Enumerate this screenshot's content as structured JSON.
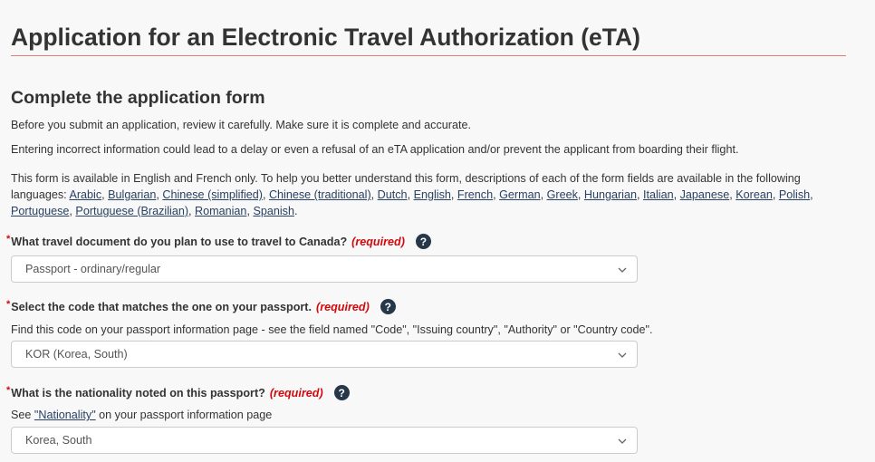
{
  "page": {
    "title": "Application for an Electronic Travel Authorization (eTA)",
    "subtitle": "Complete the application form",
    "intro1": "Before you submit an application, review it carefully. Make sure it is complete and accurate.",
    "intro2": "Entering incorrect information could lead to a delay or even a refusal of an eTA application and/or prevent the applicant from boarding their flight.",
    "intro3": "This form is available in English and French only. To help you better understand this form, descriptions of each of the form fields are available in the following languages:"
  },
  "languages": [
    "Arabic",
    "Bulgarian",
    "Chinese (simplified)",
    "Chinese (traditional)",
    "Dutch",
    "English",
    "French",
    "German",
    "Greek",
    "Hungarian",
    "Italian",
    "Japanese",
    "Korean",
    "Polish",
    "Portuguese",
    "Portuguese (Brazilian)",
    "Romanian",
    "Spanish"
  ],
  "required_marker": "*",
  "required_label": "(required)",
  "questions": [
    {
      "label": "What travel document do you plan to use to travel to Canada?",
      "hint": "",
      "value": "Passport - ordinary/regular"
    },
    {
      "label": "Select the code that matches the one on your passport.",
      "hint": "Find this code on your passport information page - see the field named \"Code\", \"Issuing country\", \"Authority\" or \"Country code\".",
      "value": "KOR (Korea, South)"
    },
    {
      "label": "What is the nationality noted on this passport?",
      "hint_prefix": "See ",
      "hint_link": "\"Nationality\"",
      "hint_suffix": " on your passport information page",
      "value": "Korea, South"
    }
  ],
  "colors": {
    "required": "#d3080c",
    "link": "#284162",
    "help_icon": "#26374a",
    "title_rule": "#d9534f"
  },
  "icons": {
    "help": "question-mark-circle-icon",
    "select": "chevron-down-icon"
  }
}
